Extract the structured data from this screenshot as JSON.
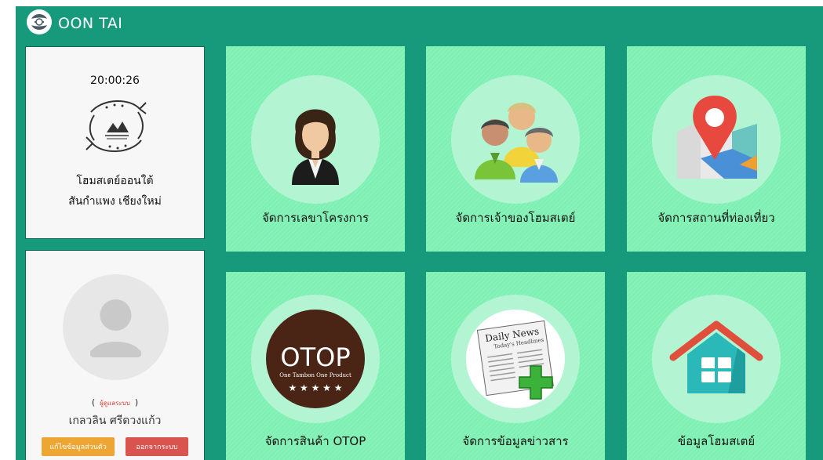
{
  "brand": {
    "name": "OON TAI",
    "logo_icon": "fish-logo-icon"
  },
  "info_panel": {
    "clock": "20:00:26",
    "homestay_name": "โฮมสเตย์ออนใต้",
    "homestay_place": "สันกำแพง เชียงใหม่"
  },
  "user_panel": {
    "paren_open": "(",
    "role": "ผู้ดูแลระบบ",
    "paren_close": ")",
    "user_name": "เกลวลิน ศรีดวงแก้ว",
    "edit_button": "แก้ไขข้อมูลส่วนตัว",
    "logout_button": "ออกจากระบบ"
  },
  "tiles": [
    {
      "label": "จัดการเลขาโครงการ",
      "icon": "secretary-woman-icon"
    },
    {
      "label": "จัดการเจ้าของโฮมสเตย์",
      "icon": "owners-group-icon"
    },
    {
      "label": "จัดการสถานที่ท่องเที่ยว",
      "icon": "map-pin-icon"
    },
    {
      "label": "จัดการสินค้า OTOP",
      "icon": "otop-badge-icon",
      "badge_title": "OTOP",
      "badge_sub": "One Tambon One Product",
      "badge_stars": "★ ★ ★ ★ ★"
    },
    {
      "label": "จัดการข้อมูลข่าวสาร",
      "icon": "newspaper-add-icon",
      "paper_title": "Daily News",
      "paper_sub": "Today's Headlines"
    },
    {
      "label": "ข้อมูลโฮมสเตย์",
      "icon": "house-icon"
    }
  ],
  "colors": {
    "background": "#17997c",
    "tile": "#7ff0b3",
    "tile_circle": "#b3f5d2",
    "edit_button": "#eda534",
    "logout_button": "#d9534f"
  }
}
